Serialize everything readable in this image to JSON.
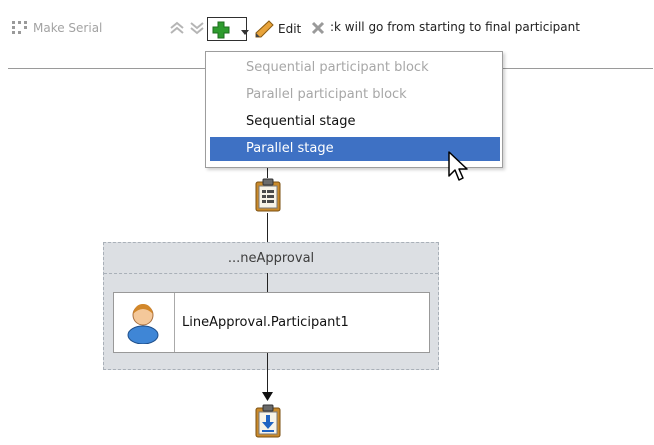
{
  "toolbar": {
    "make_serial_label": "Make Serial",
    "edit_label": "Edit",
    "truncated_text": ":k will go from starting to final participant",
    "icons": {
      "make_serial": "make-serial-icon",
      "move_up": "double-chevron-up-icon",
      "move_down": "double-chevron-down-icon",
      "add": "green-plus-icon",
      "edit": "pencil-icon",
      "delete": "gray-x-icon"
    }
  },
  "add_menu": {
    "items": [
      {
        "label": "Sequential participant block",
        "state": "disabled"
      },
      {
        "label": "Parallel participant block",
        "state": "disabled"
      },
      {
        "label": "Sequential stage",
        "state": "enabled"
      },
      {
        "label": "Parallel stage",
        "state": "selected"
      }
    ]
  },
  "diagram": {
    "start_icon": "clipboard-list-icon",
    "stage": {
      "label": "...neApproval",
      "participant": {
        "label": "LineApproval.Participant1",
        "icon": "user-avatar-icon"
      }
    },
    "end_icon": "clipboard-download-icon"
  },
  "colors": {
    "selection": "#3e71c4",
    "stage_background": "#dcdfe3",
    "disabled_text": "#a3a3a3",
    "add_icon": "#2e9b2e"
  }
}
